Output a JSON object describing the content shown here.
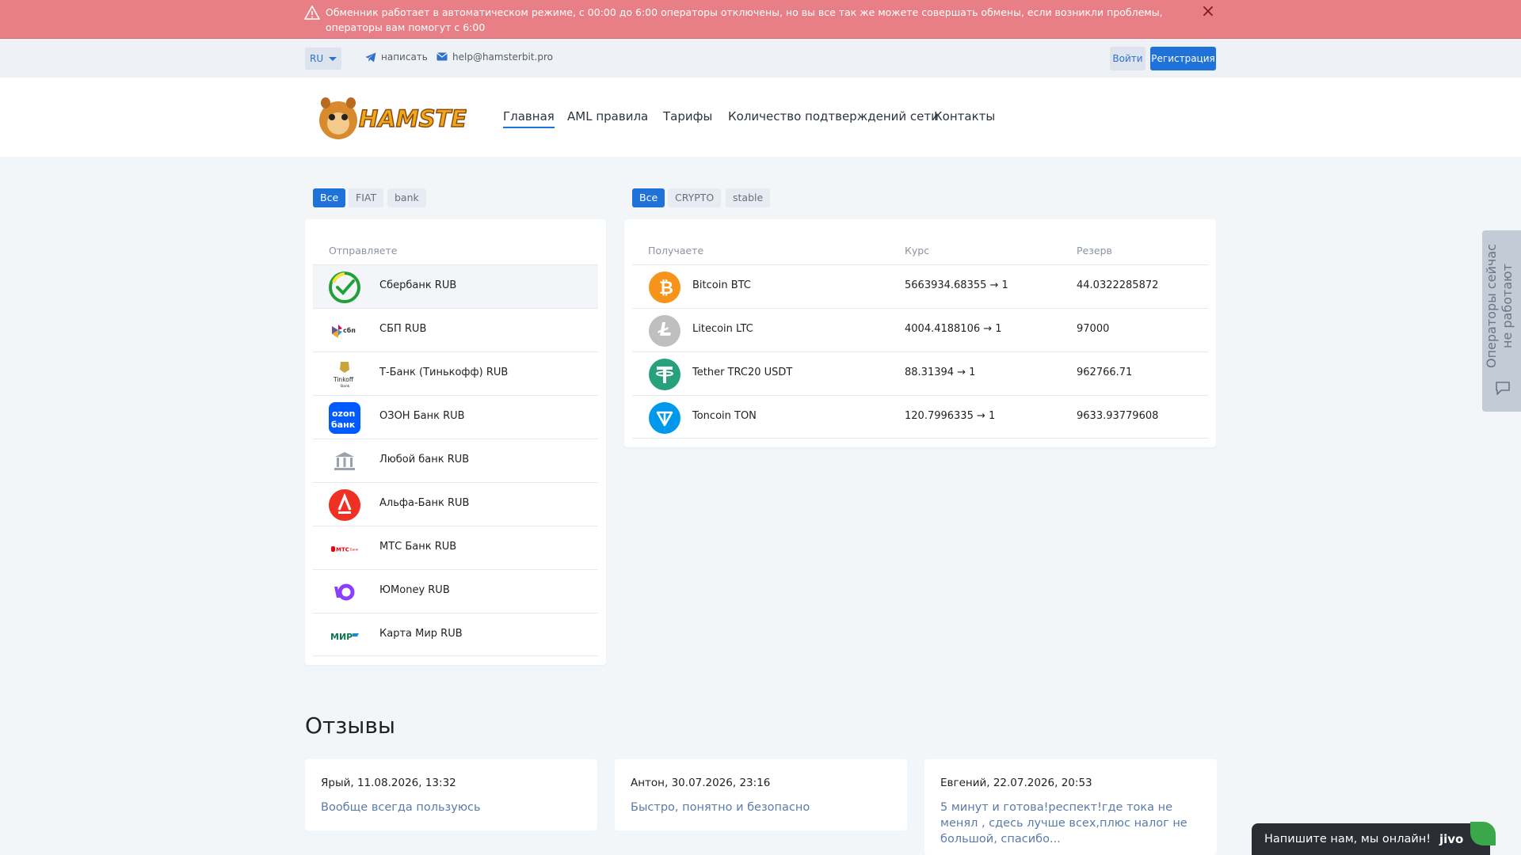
{
  "alert": {
    "text": "Обменник работает в автоматическом режиме, с 00:00 до 6:00 операторы отключены, но вы все так же можете совершать обмены, если возникли проблемы, операторы вам помогут с 6:00",
    "close_icon": "×"
  },
  "topbar": {
    "language": "RU",
    "telegram_label": "написать",
    "email_label": "help@hamsterbit.pro",
    "login_label": "Войти",
    "register_label": "Регистрация"
  },
  "header": {
    "logo_text": "HAMSTERBIT",
    "nav": {
      "home": "Главная",
      "aml": "AML правила",
      "tariffs": "Тарифы",
      "confirmations": "Количество подтверждений сети",
      "contacts": "Контакты"
    }
  },
  "send": {
    "filters": [
      "Все",
      "FIAT",
      "bank"
    ],
    "header": "Отправляете",
    "items": [
      {
        "name": "Сбербанк RUB",
        "icon": "sberbank-icon",
        "selected": true
      },
      {
        "name": "СБП RUB",
        "icon": "sbp-icon"
      },
      {
        "name": "Т-Банк (Тинькофф) RUB",
        "icon": "tinkoff-icon"
      },
      {
        "name": "ОЗОН Банк RUB",
        "icon": "ozon-bank-icon"
      },
      {
        "name": "Любой банк RUB",
        "icon": "bank-building-icon"
      },
      {
        "name": "Альфа-Банк RUB",
        "icon": "alfa-bank-icon"
      },
      {
        "name": "МТС Банк RUB",
        "icon": "mts-bank-icon"
      },
      {
        "name": "ЮMoney RUB",
        "icon": "yoomoney-icon"
      },
      {
        "name": "Карта Мир RUB",
        "icon": "mir-card-icon"
      }
    ]
  },
  "receive": {
    "filters": [
      "Все",
      "CRYPTO",
      "stable"
    ],
    "headers": {
      "name": "Получаете",
      "rate": "Курс",
      "reserve": "Резерв"
    },
    "items": [
      {
        "name": "Bitcoin BTC",
        "rate": "5663934.68355 → 1",
        "reserve": "44.0322285872",
        "icon": "bitcoin-icon",
        "color": "#f7931a"
      },
      {
        "name": "Litecoin LTC",
        "rate": "4004.4188106 → 1",
        "reserve": "97000",
        "icon": "litecoin-icon",
        "color": "#bfbfbf"
      },
      {
        "name": "Tether TRC20 USDT",
        "rate": "88.31394 → 1",
        "reserve": "962766.71",
        "icon": "tether-icon",
        "color": "#26a17b"
      },
      {
        "name": "Toncoin TON",
        "rate": "120.7996335 → 1",
        "reserve": "9633.93779608",
        "icon": "toncoin-icon",
        "color": "#0098ea"
      }
    ]
  },
  "reviews": {
    "title": "Отзывы",
    "items": [
      {
        "author": "Ярый, 11.08.2026, 13:32",
        "text": "Вообще всегда пользуюсь"
      },
      {
        "author": "Антон, 30.07.2026, 23:16",
        "text": "Быстро, понятно и безопасно"
      },
      {
        "author": "Евгений, 22.07.2026, 20:53",
        "text": "5 минут и готова!респект!где тока не менял , сдесь лучше всех,плюс налог не большой, спасибо..."
      }
    ]
  },
  "side_widget": {
    "text": "Операторы сейчас не работают"
  },
  "chat": {
    "text": "Напишите нам, мы онлайн!",
    "brand": "jivo"
  },
  "colors": {
    "accent": "#1f72d8",
    "alert_bg": "#e87f86"
  }
}
